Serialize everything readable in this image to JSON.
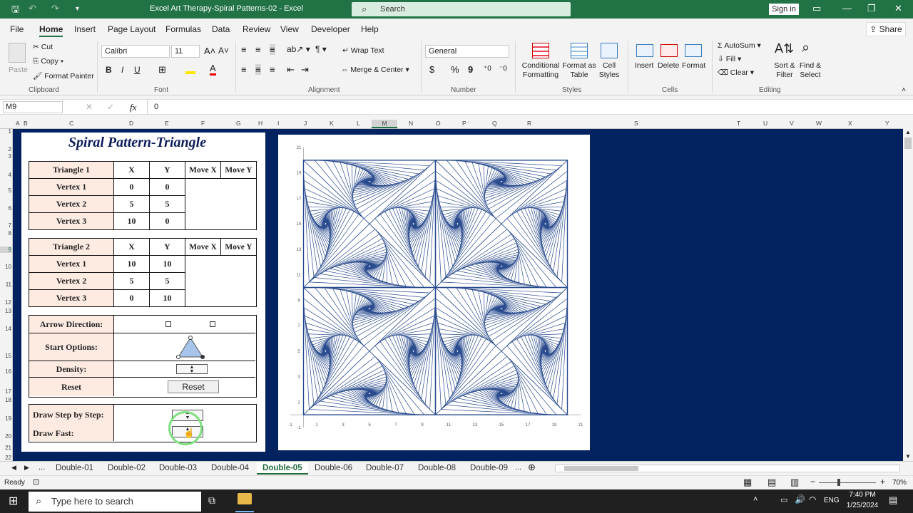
{
  "window": {
    "title": "Excel Art Therapy-Spiral Patterns-02  -  Excel",
    "search_placeholder": "Search",
    "signin": "Sign in"
  },
  "menu": [
    "File",
    "Home",
    "Insert",
    "Page Layout",
    "Formulas",
    "Data",
    "Review",
    "View",
    "Developer",
    "Help"
  ],
  "share": "Share",
  "ribbon": {
    "clipboard": {
      "paste": "Paste",
      "cut": "Cut",
      "copy": "Copy",
      "format_painter": "Format Painter",
      "group": "Clipboard"
    },
    "font": {
      "name": "Calibri",
      "size": "11",
      "bold": "B",
      "italic": "I",
      "underline": "U",
      "group": "Font"
    },
    "alignment": {
      "wrap": "Wrap Text",
      "merge": "Merge & Center",
      "group": "Alignment"
    },
    "number": {
      "format": "General",
      "currency": "$",
      "percent": "%",
      "comma": "9",
      "group": "Number"
    },
    "styles": {
      "conditional": "Conditional Formatting",
      "format_table": "Format as Table",
      "cell_styles": "Cell Styles",
      "group": "Styles"
    },
    "cells": {
      "insert": "Insert",
      "delete": "Delete",
      "format": "Format",
      "group": "Cells"
    },
    "editing": {
      "autosum": "AutoSum",
      "fill": "Fill",
      "clear": "Clear",
      "sort": "Sort & Filter",
      "find": "Find & Select",
      "group": "Editing"
    }
  },
  "formula_bar": {
    "name_box": "M9",
    "fx": "fx",
    "value": "0"
  },
  "columns": [
    "A",
    "B",
    "C",
    "D",
    "E",
    "F",
    "G",
    "H",
    "I",
    "J",
    "K",
    "L",
    "M",
    "N",
    "O",
    "P",
    "Q",
    "R",
    "S",
    "T",
    "U",
    "V",
    "W",
    "X",
    "Y"
  ],
  "rows": [
    "1",
    "2",
    "3",
    "4",
    "5",
    "6",
    "7",
    "8",
    "9",
    "10",
    "11",
    "12",
    "13",
    "14",
    "15",
    "16",
    "17",
    "18",
    "19",
    "20",
    "21",
    "22"
  ],
  "panel": {
    "title": "Spiral Pattern-Triangle",
    "triangle1": {
      "header": [
        "Triangle  1",
        "X",
        "Y",
        "Move X",
        "Move Y"
      ],
      "rows": [
        [
          "Vertex 1",
          "0",
          "0"
        ],
        [
          "Vertex 2",
          "5",
          "5"
        ],
        [
          "Vertex 3",
          "10",
          "0"
        ]
      ]
    },
    "triangle2": {
      "header": [
        "Triangle  2",
        "X",
        "Y",
        "Move X",
        "Move Y"
      ],
      "rows": [
        [
          "Vertex 1",
          "10",
          "10"
        ],
        [
          "Vertex 2",
          "5",
          "5"
        ],
        [
          "Vertex 3",
          "0",
          "10"
        ]
      ]
    },
    "controls": {
      "arrow_direction": "Arrow  Direction:",
      "start_options": "Start Options:",
      "density": "Density:",
      "reset_label": "Reset",
      "reset_button": "Reset"
    },
    "draw": {
      "step": "Draw Step by Step:",
      "fast": "Draw Fast:"
    }
  },
  "chart_data": {
    "type": "line",
    "description_x_ticks": [
      "-1",
      "1",
      "3",
      "5",
      "7",
      "9",
      "11",
      "13",
      "15",
      "17",
      "19",
      "21"
    ],
    "y_ticks": [
      "-1",
      "1",
      "3",
      "5",
      "7",
      "9",
      "11",
      "13",
      "15",
      "17",
      "19",
      "21"
    ],
    "xlim": [
      -1,
      21
    ],
    "ylim": [
      -1,
      21
    ],
    "tiles": [
      [
        0,
        0
      ],
      [
        10,
        0
      ],
      [
        0,
        10
      ],
      [
        10,
        10
      ]
    ],
    "line_color": "#2a4b8e",
    "grid": false
  },
  "sheet_tabs": [
    "Double-01",
    "Double-02",
    "Double-03",
    "Double-04",
    "Double-05",
    "Double-06",
    "Double-07",
    "Double-08",
    "Double-09"
  ],
  "active_tab": "Double-05",
  "tab_more": "...",
  "status": {
    "ready": "Ready",
    "zoom": "70%"
  },
  "taskbar": {
    "search": "Type here to search",
    "lang": "ENG",
    "time": "7:40 PM",
    "date": "1/25/2024"
  }
}
